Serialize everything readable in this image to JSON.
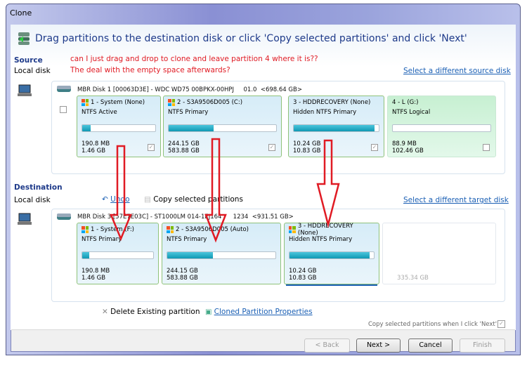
{
  "window": {
    "title": "Clone"
  },
  "heading": "Drag partitions to the destination disk or click 'Copy selected partitions' and click 'Next'",
  "annotation": {
    "line1": "can I just drag and drop to clone and leave partition 4 where it is??",
    "line2": "The deal with the empty space afterwards?",
    "color": "#e01b24"
  },
  "source": {
    "label": "Source",
    "sublabel": "Local disk",
    "select_link": "Select a different source disk",
    "disk": "MBR Disk 1 [00063D3E] - WDC WD75 00BPKX-00HPJ     01.0  <698.64 GB>",
    "partitions": [
      {
        "name": "1 - System (None)",
        "type": "NTFS Active",
        "used": "190.8 MB",
        "size": "1.46 GB",
        "fill_pct": 12,
        "checked": true
      },
      {
        "name": "2 - S3A9506D005 (C:)",
        "type": "NTFS Primary",
        "used": "244.15 GB",
        "size": "583.88 GB",
        "fill_pct": 42,
        "checked": true
      },
      {
        "name": "3 - HDDRECOVERY (None)",
        "type": "Hidden NTFS Primary",
        "used": "10.24 GB",
        "size": "10.83 GB",
        "fill_pct": 95,
        "checked": true
      },
      {
        "name": "4 - L (G:)",
        "type": "NTFS Logical",
        "used": "88.9 MB",
        "size": "102.46 GB",
        "fill_pct": 0,
        "checked": false
      }
    ]
  },
  "destination": {
    "label": "Destination",
    "sublabel": "Local disk",
    "undo": "Undo",
    "copy_selected": "Copy selected partitions",
    "select_link": "Select a different target disk",
    "disk": "MBR Disk 3 [57E7E03C] - ST1000LM 014-1EJ164      1234  <931.51 GB>",
    "partitions": [
      {
        "name": "1 - System (F:)",
        "type": "NTFS Primary",
        "used": "190.8 MB",
        "size": "1.46 GB",
        "fill_pct": 10
      },
      {
        "name": "2 - S3A9506D005 (Auto)",
        "type": "NTFS Primary",
        "used": "244.15 GB",
        "size": "583.88 GB",
        "fill_pct": 42
      },
      {
        "name": "3 - HDDRECOVERY (None)",
        "type": "Hidden NTFS Primary",
        "used": "10.24 GB",
        "size": "10.83 GB",
        "fill_pct": 95
      }
    ],
    "unallocated": "335.34 GB"
  },
  "actions": {
    "delete": "Delete Existing partition",
    "properties": "Cloned Partition Properties",
    "copy_on_next": "Copy selected partitions when I click 'Next'"
  },
  "buttons": {
    "back": "< Back",
    "next": "Next >",
    "cancel": "Cancel",
    "finish": "Finish"
  }
}
